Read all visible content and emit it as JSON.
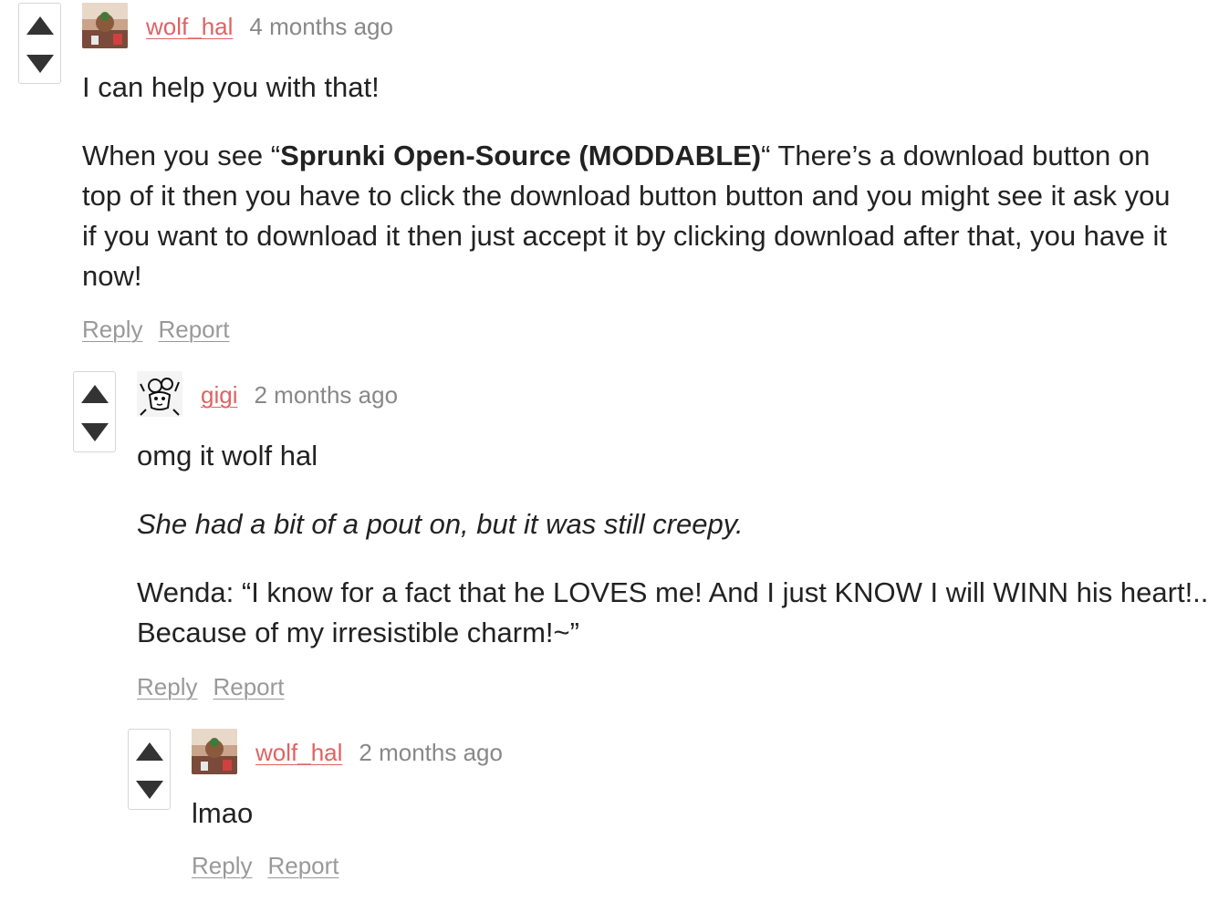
{
  "colors": {
    "username": "#e06262",
    "timestamp": "#888888",
    "action_link": "#999999",
    "text": "#222222",
    "vote_border": "#d6d6d6",
    "vote_arrow": "#333333"
  },
  "comments": [
    {
      "username": "wolf_hal",
      "timestamp": "4 months ago",
      "avatar_icon": "user-photo-avatar",
      "paragraphs": [
        "I can help you with that!"
      ],
      "rich": {
        "before": "When you see “",
        "bold": "Sprunki Open-Source (MODDABLE)",
        "after": "“ There’s a download button on top of it then you have to click the download button button and you might see it ask you if you want to download it then just accept it by clicking download after that, you have it now!"
      },
      "reply_label": "Reply",
      "report_label": "Report"
    },
    {
      "username": "gigi",
      "timestamp": "2 months ago",
      "avatar_icon": "sketch-character-avatar",
      "paragraphs": [
        "omg it wolf hal"
      ],
      "italic": "She had a bit of a pout on, but it was still creepy.",
      "quote": "Wenda: “I know for a fact that he LOVES me! And I just KNOW I will WINN his heart!.. Because of my irresistible charm!~”",
      "reply_label": "Reply",
      "report_label": "Report"
    },
    {
      "username": "wolf_hal",
      "timestamp": "2 months ago",
      "avatar_icon": "user-photo-avatar",
      "paragraphs": [
        "lmao"
      ],
      "reply_label": "Reply",
      "report_label": "Report"
    }
  ],
  "icons": {
    "upvote": "triangle-up-icon",
    "downvote": "triangle-down-icon"
  }
}
